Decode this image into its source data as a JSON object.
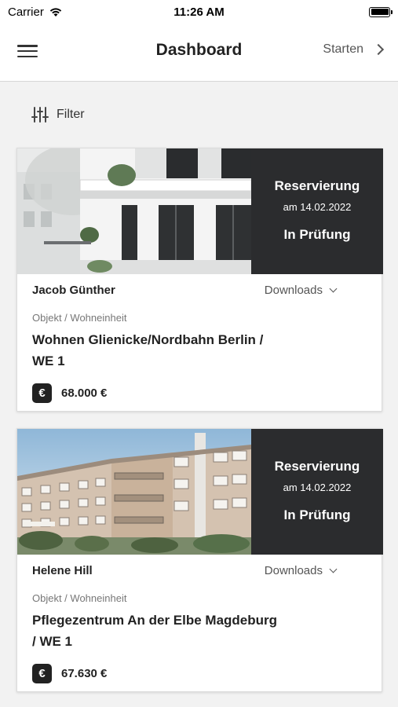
{
  "status_bar": {
    "carrier": "Carrier",
    "time": "11:26 AM"
  },
  "nav": {
    "title": "Dashboard",
    "action_label": "Starten"
  },
  "filter": {
    "label": "Filter"
  },
  "cards": [
    {
      "status_title": "Reservierung",
      "status_date": "am 14.02.2022",
      "status_state": "In Prüfung",
      "name": "Jacob Günther",
      "downloads_label": "Downloads",
      "object_label": "Objekt / Wohneinheit",
      "object_title": "Wohnen Glienicke/Nordbahn Berlin / WE 1",
      "price": "68.000 €"
    },
    {
      "status_title": "Reservierung",
      "status_date": "am 14.02.2022",
      "status_state": "In Prüfung",
      "name": "Helene Hill",
      "downloads_label": "Downloads",
      "object_label": "Objekt / Wohneinheit",
      "object_title": "Pflegezentrum An der Elbe Magdeburg / WE 1",
      "price": "67.630 €"
    }
  ],
  "icons": {
    "euro": "€"
  },
  "colors": {
    "status_panel": "#2b2c2e",
    "background": "#f2f2f2"
  }
}
